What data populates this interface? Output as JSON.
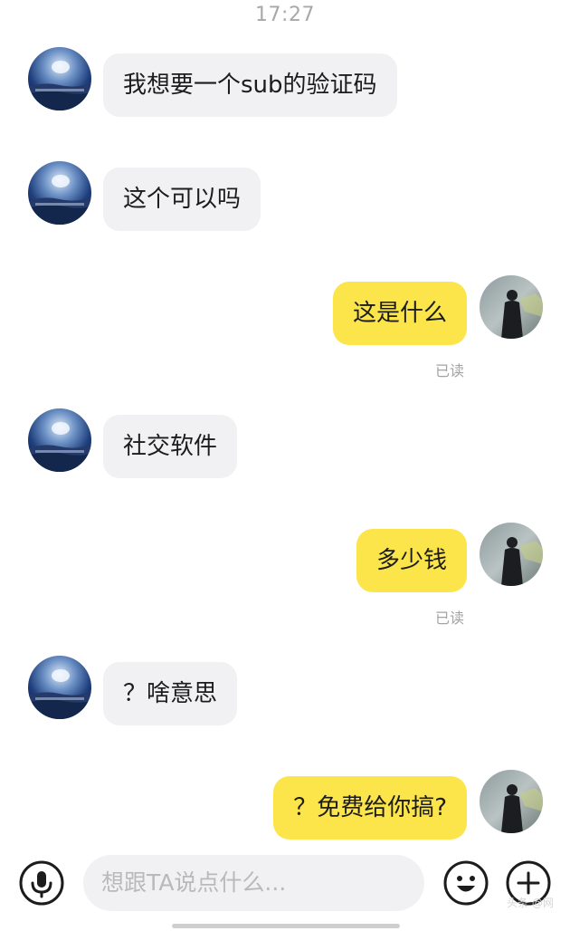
{
  "status": {
    "time": "17:27"
  },
  "messages": [
    {
      "side": "in",
      "text": "我想要一个sub的验证码"
    },
    {
      "side": "in",
      "text": "这个可以吗"
    },
    {
      "side": "out",
      "text": "这是什么",
      "receipt": "已读"
    },
    {
      "side": "in",
      "text": "社交软件"
    },
    {
      "side": "out",
      "text": "多少钱",
      "receipt": "已读"
    },
    {
      "side": "in",
      "text": "？啥意思"
    },
    {
      "side": "out",
      "text": "？免费给你搞?"
    }
  ],
  "composer": {
    "placeholder": "想跟TA说点什么...",
    "voice_icon": "microphone-icon",
    "emoji_icon": "emoji-icon",
    "more_icon": "plus-icon"
  },
  "watermark": "头条 @网"
}
